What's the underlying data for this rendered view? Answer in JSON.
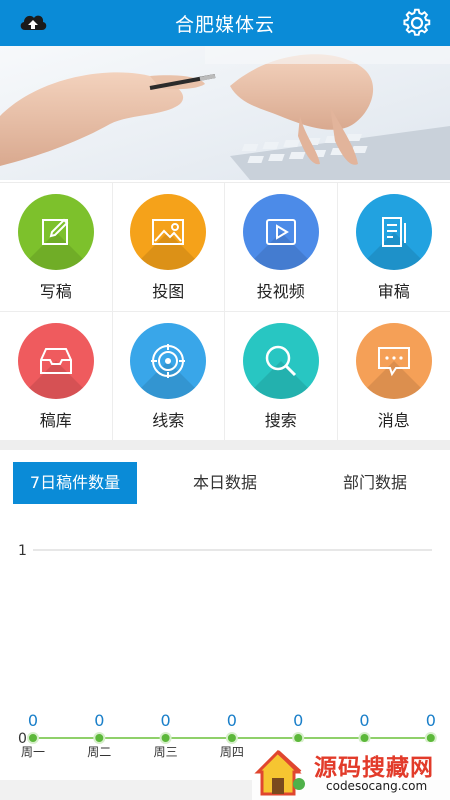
{
  "header": {
    "title": "合肥媒体云",
    "left_icon": "cloud-upload-icon",
    "right_icon": "gear-icon"
  },
  "grid": {
    "items": [
      {
        "label": "写稿",
        "icon": "pencil-edit-icon",
        "color": "#7dc12c"
      },
      {
        "label": "投图",
        "icon": "image-icon",
        "color": "#f5a21a"
      },
      {
        "label": "投视频",
        "icon": "video-play-icon",
        "color": "#4c8be8"
      },
      {
        "label": "审稿",
        "icon": "document-icon",
        "color": "#22a2e0"
      },
      {
        "label": "稿库",
        "icon": "inbox-icon",
        "color": "#ef5b5e"
      },
      {
        "label": "线索",
        "icon": "target-icon",
        "color": "#39a6e9"
      },
      {
        "label": "搜索",
        "icon": "search-icon",
        "color": "#28c6c2"
      },
      {
        "label": "消息",
        "icon": "message-icon",
        "color": "#f5a057"
      }
    ]
  },
  "tabs": [
    {
      "label": "7日稿件数量",
      "active": true
    },
    {
      "label": "本日数据",
      "active": false
    },
    {
      "label": "部门数据",
      "active": false
    }
  ],
  "chart_data": {
    "type": "line",
    "categories": [
      "周一",
      "周二",
      "周三",
      "周四",
      "",
      "",
      ""
    ],
    "values": [
      0,
      0,
      0,
      0,
      0,
      0,
      0
    ],
    "y_tick_labels": [
      "0",
      "1"
    ],
    "ylim": [
      0,
      1
    ],
    "grid": true,
    "line_color": "#8fd06a",
    "point_color": "#5cb83a",
    "value_label_color": "#1a7fc9"
  },
  "watermark": {
    "text": "源码搜藏网",
    "url": "codesocang.com"
  }
}
